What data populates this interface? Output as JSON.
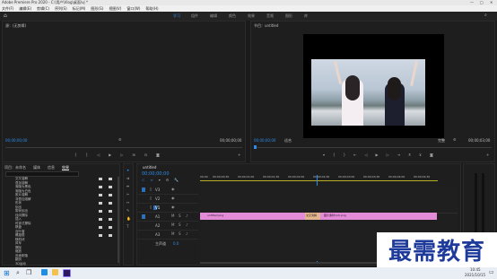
{
  "app": {
    "title": "Adobe Premiere Pro 2020 - C:\\用户\\Vlog\\桌面\\vj *",
    "menu": [
      "文件(F)",
      "编辑(E)",
      "剪辑(C)",
      "序列(S)",
      "标记(M)",
      "图形(G)",
      "视图(V)",
      "窗口(W)",
      "帮助(H)"
    ],
    "workspaces": [
      "学习",
      "组件",
      "编辑",
      "颜色",
      "效果",
      "音频",
      "图形",
      "库"
    ],
    "active_workspace": "学习"
  },
  "source_panel": {
    "title": "源：(无剪辑)",
    "timecode_left": "00;00;00;00",
    "timecode_right": "00;00;00;00"
  },
  "program_panel": {
    "title": "节目：untitled",
    "timecode": "00;00;00;00",
    "fit": "适合",
    "quality": "完整",
    "duration": "00;00;03;00"
  },
  "project_panel": {
    "tabs": [
      "项目：未命名",
      "媒体",
      "信息",
      "效果"
    ],
    "active_tab": "效果",
    "items": [
      "交叉溶解",
      "叠加溶解",
      "渐隐为黑色",
      "渐隐为白色",
      "胶片溶解",
      "非叠加溶解",
      "形状",
      "划出",
      "带状划出",
      "径向擦除",
      "插入",
      "时钟式擦除",
      "棋盘",
      "百叶窗",
      "螺旋框",
      "随机块",
      "风车",
      "擦除",
      "缩放",
      "页面剥落",
      "翻页",
      "3D运动"
    ]
  },
  "timeline": {
    "title": "untitled",
    "timecode": "00;00;00;00",
    "ruler": [
      "00;00",
      "00;00;00;30",
      "00;00;01;00",
      "00;00;01;30",
      "00;00;02;00",
      "00;00;02;30",
      "00;00;03;00",
      "00;00;03;30",
      "00;00;04;00",
      "00;00;04;30"
    ],
    "tracks": [
      "V3",
      "V2",
      "V1",
      "A1",
      "A2",
      "A3",
      "主声道"
    ],
    "clips": [
      {
        "label": "untitled.png"
      },
      {
        "label": "交叉溶解"
      },
      {
        "label": "图片素材1(2).png"
      }
    ],
    "master_value": "0.0"
  },
  "taskbar": {
    "time": "10:45",
    "date": "2021/10/15"
  },
  "watermark": "最需教育",
  "colors": {
    "accent": "#2d8ceb",
    "clip": "#e38bd7",
    "transition": "#e0b58f"
  }
}
